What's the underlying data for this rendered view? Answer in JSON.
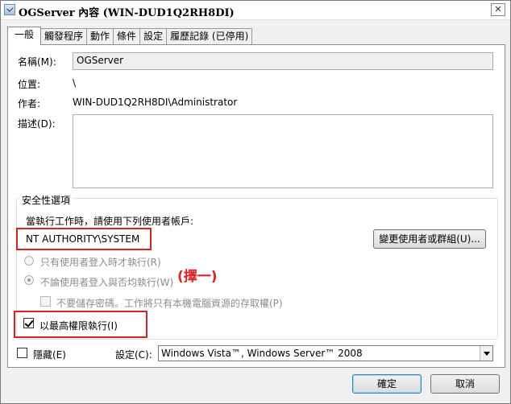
{
  "window": {
    "title": "OGServer 內容 (WIN-DUD1Q2RH8DI)",
    "close": "✕"
  },
  "tabs": [
    {
      "label": "一般"
    },
    {
      "label": "觸發程序"
    },
    {
      "label": "動作"
    },
    {
      "label": "條件"
    },
    {
      "label": "設定"
    },
    {
      "label": "履歷記錄 (已停用)"
    }
  ],
  "general": {
    "name_label": "名稱(M):",
    "name_value": "OGServer",
    "location_label": "位置:",
    "location_value": "\\",
    "author_label": "作者:",
    "author_value": "WIN-DUD1Q2RH8DI\\Administrator",
    "description_label": "描述(D):",
    "description_value": ""
  },
  "security": {
    "group_title": "安全性選項",
    "prompt": "當執行工作時，請使用下列使用者帳戶:",
    "account": "NT AUTHORITY\\SYSTEM",
    "change_user_button": "變更使用者或群組(U)...",
    "radio_logged_on": "只有使用者登入時才執行(R)",
    "radio_whether": "不論使用者登入與否均執行(W)",
    "no_store_password": "不要儲存密碼。工作將只有本機電腦資源的存取權(P)",
    "run_highest": "以最高權限執行(I)",
    "annotation": "(擇一)"
  },
  "bottom": {
    "hidden_label": "隱藏(E)",
    "configure_label": "設定(C):",
    "configure_value": "Windows Vista™, Windows Server™ 2008"
  },
  "buttons": {
    "ok": "確定",
    "cancel": "取消"
  },
  "colors": {
    "annotation": "#e02020",
    "tab_border": "#898c95"
  }
}
